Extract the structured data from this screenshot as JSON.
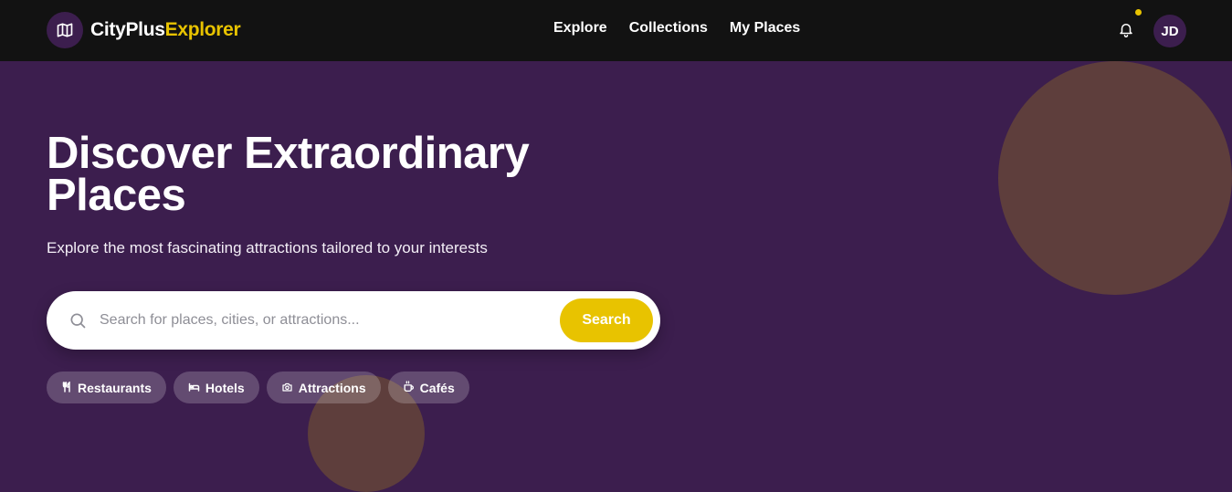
{
  "brand": {
    "name_part1": "CityPlus",
    "name_part2": "Explorer",
    "logo_icon": "map-icon"
  },
  "nav": {
    "items": [
      "Explore",
      "Collections",
      "My Places"
    ]
  },
  "header": {
    "notification_icon": "bell-icon",
    "has_unread": true,
    "avatar_initials": "JD"
  },
  "hero": {
    "title": "Discover Extraordinary Places",
    "subtitle": "Explore the most fascinating attractions tailored to your interests"
  },
  "search": {
    "placeholder": "Search for places, cities, or attractions...",
    "value": "",
    "button_label": "Search",
    "icon": "search-icon"
  },
  "categories": [
    {
      "label": "Restaurants",
      "icon": "utensils-icon"
    },
    {
      "label": "Hotels",
      "icon": "bed-icon"
    },
    {
      "label": "Attractions",
      "icon": "camera-icon"
    },
    {
      "label": "Cafés",
      "icon": "coffee-icon"
    }
  ],
  "colors": {
    "header_bg": "#121212",
    "hero_bg": "#3c1e4e",
    "accent": "#e8c300",
    "decor": "#5e3e3c"
  }
}
